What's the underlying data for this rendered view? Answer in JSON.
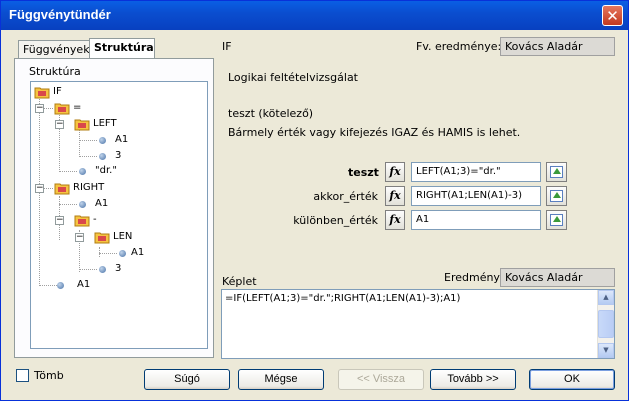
{
  "window": {
    "title": "Függvénytündér",
    "close_glyph": "✕"
  },
  "tabs": [
    {
      "label": "Függvények",
      "active": false
    },
    {
      "label": "Struktúra",
      "active": true
    }
  ],
  "tree": {
    "label": "Struktúra",
    "nodes": [
      {
        "text": "IF",
        "kind": "folder",
        "level": 0
      },
      {
        "text": "=",
        "kind": "folder",
        "level": 1
      },
      {
        "text": "LEFT",
        "kind": "folder",
        "level": 2
      },
      {
        "text": "A1",
        "kind": "leaf",
        "level": 3
      },
      {
        "text": "3",
        "kind": "leaf",
        "level": 3
      },
      {
        "text": "\"dr.\"",
        "kind": "leaf",
        "level": 2
      },
      {
        "text": "RIGHT",
        "kind": "folder",
        "level": 1
      },
      {
        "text": "A1",
        "kind": "leaf",
        "level": 2
      },
      {
        "text": "-",
        "kind": "folder",
        "level": 2
      },
      {
        "text": "LEN",
        "kind": "folder",
        "level": 3
      },
      {
        "text": "A1",
        "kind": "leaf",
        "level": 4
      },
      {
        "text": "3",
        "kind": "leaf",
        "level": 3
      },
      {
        "text": "A1",
        "kind": "leaf",
        "level": 1
      }
    ]
  },
  "function": {
    "name": "IF",
    "result_label": "Fv. eredménye:",
    "result_value": "Kovács Aladár",
    "description": "Logikai feltételvizsgálat",
    "param_title": "teszt (kötelező)",
    "param_desc": "Bármely érték vagy kifejezés IGAZ és HAMIS is lehet."
  },
  "params": [
    {
      "label": "teszt",
      "value": "LEFT(A1;3)=\"dr.\"",
      "bold": true
    },
    {
      "label": "akkor_érték",
      "value": "RIGHT(A1;LEN(A1)-3)",
      "bold": false
    },
    {
      "label": "különben_érték",
      "value": "A1",
      "bold": false
    }
  ],
  "fx_label": "fx",
  "formula": {
    "label": "Képlet",
    "result_label": "Eredmény",
    "result_value": "Kovács Aladár",
    "text": "=IF(LEFT(A1;3)=\"dr.\";RIGHT(A1;LEN(A1)-3);A1)"
  },
  "footer": {
    "array_label": "Tömb",
    "help": "Súgó",
    "cancel": "Mégse",
    "back": "<< Vissza",
    "next": "Tovább >>",
    "ok": "OK"
  }
}
